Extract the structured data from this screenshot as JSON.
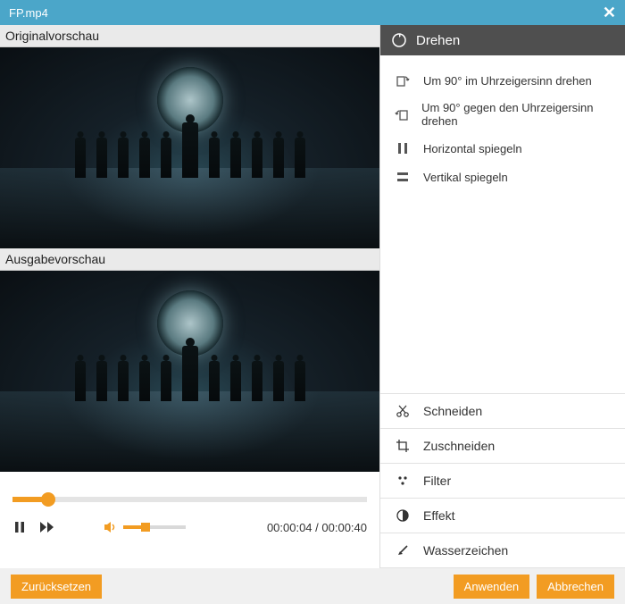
{
  "titlebar": {
    "filename": "FP.mp4"
  },
  "preview": {
    "original_label": "Originalvorschau",
    "output_label": "Ausgabevorschau"
  },
  "player": {
    "current_time": "00:00:04",
    "total_time": "00:00:40"
  },
  "rotate": {
    "header": "Drehen",
    "options": [
      {
        "icon": "rotate-cw",
        "label": "Um 90° im Uhrzeigersinn drehen"
      },
      {
        "icon": "rotate-ccw",
        "label": "Um 90° gegen den Uhrzeigersinn drehen"
      },
      {
        "icon": "flip-h",
        "label": "Horizontal spiegeln"
      },
      {
        "icon": "flip-v",
        "label": "Vertikal spiegeln"
      }
    ]
  },
  "tabs": [
    {
      "icon": "cut",
      "label": "Schneiden"
    },
    {
      "icon": "crop",
      "label": "Zuschneiden"
    },
    {
      "icon": "filter",
      "label": "Filter"
    },
    {
      "icon": "effect",
      "label": "Effekt"
    },
    {
      "icon": "watermark",
      "label": "Wasserzeichen"
    }
  ],
  "footer": {
    "reset": "Zurücksetzen",
    "apply": "Anwenden",
    "cancel": "Abbrechen"
  }
}
